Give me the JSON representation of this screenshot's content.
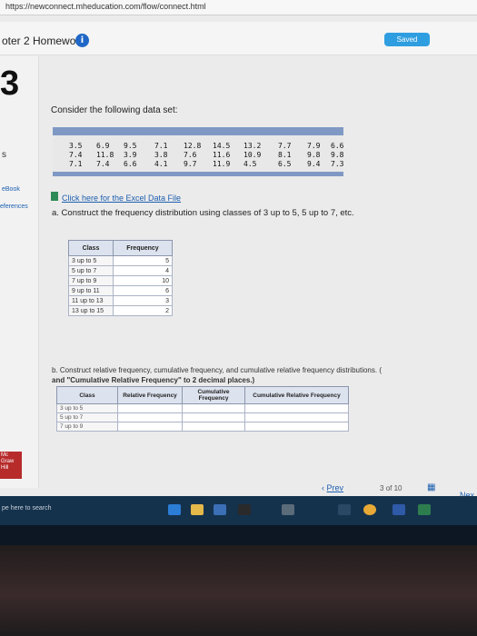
{
  "browser": {
    "url": "https://newconnect.mheducation.com/flow/connect.html"
  },
  "header": {
    "title": "oter 2 Homework",
    "info_icon": "i",
    "saved": "Saved"
  },
  "sidebar": {
    "question_number": "3",
    "s_label": "s",
    "ebook": "eBook",
    "references": "eferences",
    "mh_logo": "Mc Graw Hill"
  },
  "question": {
    "prompt": "Consider the following data set:",
    "data_rows": [
      [
        "3.5",
        "6.9",
        "9.5",
        "7.1",
        "12.8",
        "14.5",
        "13.2",
        "7.7",
        "7.9",
        "6.6"
      ],
      [
        "7.4",
        "11.8",
        "3.9",
        "3.8",
        "7.6",
        "11.6",
        "10.9",
        "8.1",
        "9.8",
        "9.8"
      ],
      [
        "7.1",
        "7.4",
        "6.6",
        "4.1",
        "9.7",
        "11.9",
        "4.5",
        "6.5",
        "9.4",
        "7.3"
      ]
    ],
    "excel_link": "Click here for the Excel Data File",
    "part_a": "a. Construct the frequency distribution using classes of 3 up to 5, 5 up to 7, etc.",
    "freq_table": {
      "headers": [
        "Class",
        "Frequency"
      ],
      "rows": [
        {
          "class": "3 up to 5",
          "freq": "5"
        },
        {
          "class": "5 up to 7",
          "freq": "4"
        },
        {
          "class": "7 up to 9",
          "freq": "10"
        },
        {
          "class": "9 up to 11",
          "freq": "6"
        },
        {
          "class": "11 up to 13",
          "freq": "3"
        },
        {
          "class": "13 up to 15",
          "freq": "2"
        }
      ]
    },
    "part_b_line1": "b. Construct relative frequency, cumulative frequency, and cumulative relative frequency distributions. (",
    "part_b_line2": "and \"Cumulative Relative Frequency\" to 2 decimal places.)",
    "rel_table": {
      "headers": [
        "Class",
        "Relative Frequency",
        "Cumulative Frequency",
        "Cumulative Relative Frequency"
      ],
      "rows": [
        {
          "class": "3 up to 5"
        },
        {
          "class": "5 up to 7"
        },
        {
          "class": "7 up to 9"
        }
      ]
    }
  },
  "navigation": {
    "prev": "Prev",
    "page_current": "3",
    "page_of": "of",
    "page_total": "10",
    "next": "Nex"
  },
  "taskbar": {
    "search_placeholder": "pe here to search"
  },
  "colors": {
    "accent": "#1b5fb0",
    "saved_bg": "#2f9ee0",
    "table_header": "#7f99c4",
    "taskbar": "#15324d"
  }
}
